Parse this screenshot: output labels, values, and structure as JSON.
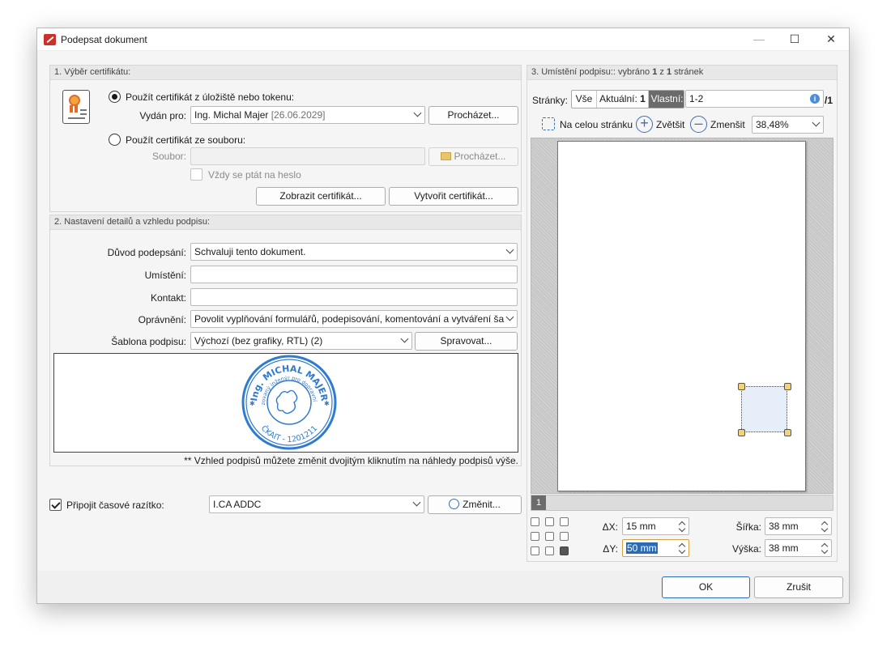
{
  "window": {
    "title": "Podepsat dokument",
    "minimize": "—",
    "maximize": "☐",
    "close": "✕"
  },
  "section1": {
    "title": "1. Výběr certifikátu:",
    "radio_store": "Použít certifikát z úložiště nebo tokenu:",
    "issued_for_label": "Vydán pro:",
    "issued_for_name": "Ing. Michal Majer",
    "issued_for_date": "[26.06.2029]",
    "browse_label": "Procházet...",
    "radio_file": "Použít certifikát ze souboru:",
    "file_label": "Soubor:",
    "file_value": "",
    "browse_file_label": "Procházet...",
    "always_ask": "Vždy se ptát na heslo",
    "show_cert": "Zobrazit certifikát...",
    "create_cert": "Vytvořit certifikát..."
  },
  "section2": {
    "title": "2. Nastavení detailů a vzhledu podpisu:",
    "reason_label": "Důvod podepsání:",
    "reason_value": "Schvaluji tento dokument.",
    "location_label": "Umístění:",
    "location_value": "",
    "contact_label": "Kontakt:",
    "contact_value": "",
    "permission_label": "Oprávnění:",
    "permission_value": "Povolit vyplňování formulářů, podepisování, komentování a vytváření ša",
    "template_label": "Šablona podpisu:",
    "template_value": "Výchozí (bez grafiky, RTL) (2)",
    "manage_label": "Spravovat...",
    "stamp": {
      "top_text": "Ing. MICHAL MAJER",
      "middle_text": "Autorizovaný inženýr pro dopravní stavby",
      "bottom_text": "ČKAIT - 1201211"
    },
    "hint": "** Vzhled podpisů můžete změnit dvojitým kliknutím na náhledy podpisů výše."
  },
  "timestamp": {
    "checkbox_label": "Připojit časové razítko:",
    "checked": true,
    "server": "I.CA ADDC",
    "change_label": "Změnit..."
  },
  "section3": {
    "title_prefix": "3. Umístění podpisu:: vybráno ",
    "selected": "1",
    "title_mid": " z ",
    "total": "1",
    "title_suffix": " stránek",
    "pages_label": "Stránky:",
    "seg_all": "Vše",
    "seg_current": "Aktuální:",
    "seg_current_num": "1",
    "seg_custom": "Vlastní:",
    "pages_value": "1-2",
    "pages_total": "/1",
    "fit_page": "Na celou stránku",
    "zoom_in": "Zvětšit",
    "zoom_out": "Zmenšit",
    "zoom_value": "38,48%",
    "page_tab": "1",
    "dx_label": "ΔX:",
    "dx_value": "15 mm",
    "dy_label": "ΔY:",
    "dy_value": "50 mm",
    "width_label": "Šířka:",
    "width_value": "38 mm",
    "height_label": "Výška:",
    "height_value": "38 mm"
  },
  "footer": {
    "ok": "OK",
    "cancel": "Zrušit"
  },
  "colors": {
    "accent": "#2b6ab5",
    "stamp": "#2f7bd0",
    "selected_segment": "#6b6b6b",
    "dialog_bg": "#f0f0f0"
  }
}
